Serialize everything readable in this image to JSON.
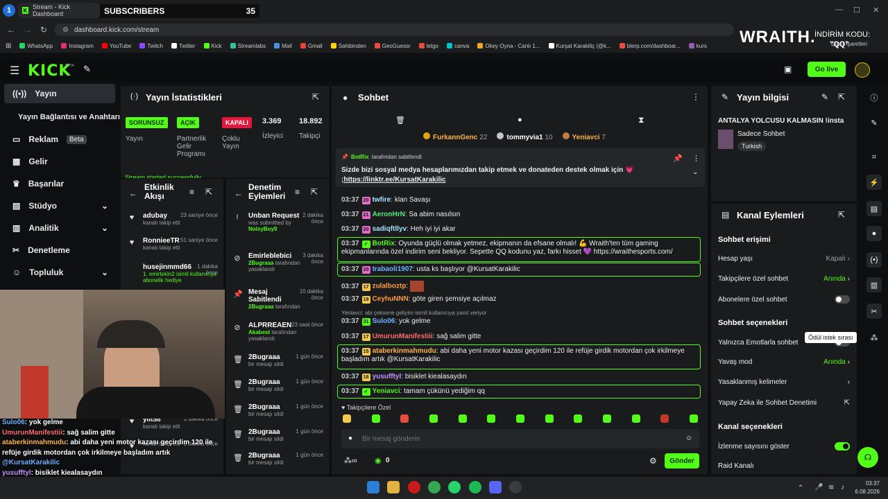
{
  "browser": {
    "tab_number": "1",
    "tab_title": "Stream - Kick Dashboard",
    "subs_label": "SUBSCRIBERS",
    "subs_count": "35",
    "url": "dashboard.kick.com/stream",
    "bookmarks": [
      "WhatsApp",
      "Instagram",
      "YouTube",
      "Twitch",
      "Twitter",
      "Kick",
      "Streamlabs",
      "Mail",
      "Gmail",
      "Sahibinden",
      "GeoGuessr",
      "letgo",
      "canva",
      "Okey Oyna - Canlı 1...",
      "Kurşat Karakiliç (@k...",
      "blerp.com/dashboar...",
      "kurs"
    ],
    "other_bookmarks": "Diğer İşaretleri"
  },
  "ad": {
    "brand": "WRAITH.",
    "code_label": "İNDİRİM KODU:",
    "code": "\"QQ\""
  },
  "header": {
    "logo": "KICK",
    "beta": "BETA",
    "go_live": "Go live"
  },
  "sidebar": {
    "items": [
      {
        "label": "Yayın",
        "icon": "broadcast-icon"
      },
      {
        "label": "Yayın Bağlantısı ve Anahtarı",
        "icon": ""
      },
      {
        "label": "Reklam",
        "icon": "monitor-icon",
        "badge": "Beta"
      },
      {
        "label": "Gelir",
        "icon": "chart-icon"
      },
      {
        "label": "Başarılar",
        "icon": "trophy-icon"
      },
      {
        "label": "Stüdyo",
        "icon": "film-icon"
      },
      {
        "label": "Analitik",
        "icon": "bar-icon"
      },
      {
        "label": "Denetleme",
        "icon": "wrench-icon"
      },
      {
        "label": "Topluluk",
        "icon": "people-icon"
      }
    ]
  },
  "stats": {
    "title": "Yayın İstatistikleri",
    "sorunsuz": "SORUNSUZ",
    "yayin": "Yayın",
    "acik": "AÇIK",
    "partner": "Partnerlik Gelir Programı",
    "kapali": "KAPALI",
    "coklu": "Çoklu Yayın",
    "viewers": "3.369",
    "viewers_label": "İzleyici",
    "followers": "18.892",
    "followers_label": "Takipçi",
    "started": "Stream started successfully"
  },
  "activity": {
    "title": "Etkinlik Akışı",
    "items": [
      {
        "name": "adubay",
        "sub": "kanalı takip etti",
        "time": "23 saniye önce"
      },
      {
        "name": "RonnieeTR",
        "sub": "kanalı takip etti",
        "time": "51 saniye önce"
      },
      {
        "name": "husejinmmd66",
        "sub": "1. emirtekin2 isimli kullanıcıya abonelik hediye",
        "time": "1 dakika önce"
      },
      {
        "name": "yiit58",
        "sub": "kanalı takip etti",
        "time": "1 dakika önce"
      },
      {
        "name": "",
        "sub": "kanalı takip etti",
        "time": "1 dakika önce"
      }
    ]
  },
  "moderation": {
    "title": "Denetim Eylemleri",
    "items": [
      {
        "name": "Unban Request",
        "sub": "was submitted by",
        "user": "NolsyBoy9",
        "time": "2 dakika önce"
      },
      {
        "name": "Emirleblebici",
        "user": "2Bugraaa",
        "sub": "tarafından yasaklandı",
        "time": "3 dakika önce"
      },
      {
        "name": "Mesaj Sabitlendi",
        "user": "2Bugraaa",
        "sub": "tarafından",
        "time": "10 dakika önce"
      },
      {
        "name": "ALPRREAEN",
        "user": "Akabest",
        "sub": "tarafından yasaklandı",
        "time": "23 saat önce"
      },
      {
        "name": "2Bugraaa",
        "sub": "bir mesajı sildi",
        "time": "1 gün önce"
      },
      {
        "name": "2Bugraaa",
        "sub": "bir mesajı sildi",
        "time": "1 gün önce"
      },
      {
        "name": "2Bugraaa",
        "sub": "bir mesajı sildi",
        "time": "1 gün önce"
      },
      {
        "name": "2Bugraaa",
        "sub": "bir mesajı sildi",
        "time": "1 gün önce"
      },
      {
        "name": "2Bugraaa",
        "sub": "bir mesajı sildi",
        "time": "1 gün önce"
      }
    ]
  },
  "chat": {
    "title": "Sohbet",
    "top": [
      {
        "name": "FurkannGenc",
        "count": "22"
      },
      {
        "name": "tommyvia1",
        "count": "10"
      },
      {
        "name": "Yeniavci",
        "count": "7"
      }
    ],
    "pinned_by": "BotRix",
    "pinned_suffix": "tarafından sabitlendi",
    "pinned_text": "Sizde bizi sosyal medya hesaplarımızdan takip etmek ve donateden destek olmak için 💗",
    "pinned_link": ";https://linktr.ee/KursatKarakilic",
    "messages": [
      {
        "time": "03:37",
        "lvl": "20",
        "user": "twfire",
        "text": "klan Savaşı",
        "color": "#a9e2ff"
      },
      {
        "time": "03:37",
        "lvl": "21",
        "user": "AeronHrN",
        "text": "Sa abim nasılsın",
        "color": "#57ec7d"
      },
      {
        "time": "03:37",
        "lvl": "20",
        "user": "sadiqftllyv",
        "text": "Heh iyi iyi akar",
        "color": "#a9e2ff"
      },
      {
        "time": "03:37",
        "lvl": "",
        "user": "BotRix",
        "text": "Oyunda güçlü olmak yetmez, ekipmanın da efsane olmalı! 💪 Wraith'ten tüm gaming",
        "text2": "ekipmanlarında özel indirim seni bekliyor. Sepette QQ kodunu yaz, farkı hisset 💜 https://wraithesports.com/",
        "color": "#53fc18"
      },
      {
        "time": "03:37",
        "lvl": "20",
        "user": "trabaoli1907",
        "text": "usta ks başlıyor @KursatKarakilic",
        "color": "#6fb2ff"
      },
      {
        "time": "03:37",
        "lvl": "17",
        "user": "zulalboztp",
        "text": "",
        "color": "#ff9b3d"
      },
      {
        "time": "03:37",
        "lvl": "19",
        "user": "CeyhuNNN",
        "text": "göte giren şemsiye açılmaz",
        "color": "#ff9b3d"
      },
      {
        "time": "",
        "lvl": "",
        "user": "",
        "text": "Yeniavci: abi çeksene geliyim isimli kullanıcıya yanıt veriyor",
        "color": "#9aa0a3"
      },
      {
        "time": "03:37",
        "lvl": "31",
        "user": "Sulo06",
        "text": "yok gelme",
        "color": "#6fb2ff"
      },
      {
        "time": "03:37",
        "lvl": "17",
        "user": "UmurunManifestiii",
        "text": "sağ salim gitte",
        "color": "#ff6b6b"
      },
      {
        "time": "03:37",
        "lvl": "15",
        "user": "ataberkinmahmudu",
        "text": "abi daha yeni motor kazası geçirdim 120 ile refüje girdik motordan çok irkilmeye",
        "text2": "başladım artık @KursatKarakilic",
        "color": "#ffb44a"
      },
      {
        "time": "03:37",
        "lvl": "18",
        "user": "yusufftyl",
        "text": "bisiklet kiealasaydın",
        "color": "#c792ff"
      },
      {
        "time": "03:37",
        "lvl": "",
        "user": "Yeniavci",
        "text": "tamam çükünü yediğim qq",
        "color": "#53fc18"
      }
    ],
    "followers_only": "Takipçilere Özel",
    "placeholder": "Bir mesaj gönderin",
    "points": "0",
    "send": "Gönder"
  },
  "info": {
    "title": "Yayın bilgisi",
    "stream_title": "ANTALYA YOLCUSU KALMASIN !insta",
    "category": "Sadece Sohbet",
    "language": "Turkish"
  },
  "channel": {
    "title": "Kanal Eylemleri",
    "chat_access": "Sohbet erişimi",
    "rows": [
      {
        "label": "Hesap yaşı",
        "value": "Kapalı"
      },
      {
        "label": "Takipçilere özel sohbet",
        "value": "Anında"
      },
      {
        "label": "Abonelere özel sohbet",
        "value": ""
      }
    ],
    "chat_options": "Sohbet seçenekleri",
    "rows2": [
      {
        "label": "Yalnızca Emotlarla sohbet",
        "value": ""
      },
      {
        "label": "Yavaş mod",
        "value": "Anında"
      },
      {
        "label": "Yasaklanmış kelimeler",
        "value": ""
      },
      {
        "label": "Yapay Zeka ile Sohbet Denetimi",
        "value": ""
      }
    ],
    "channel_options": "Kanal seçenekleri",
    "rows3": [
      {
        "label": "İzlenme sayısını göster",
        "value": ""
      },
      {
        "label": "Raid Kanalı",
        "value": ""
      }
    ],
    "tooltip": "Ödül istek sırası"
  },
  "overlay": {
    "lines": [
      {
        "user": "Sulo06",
        "text": ": yok gelme",
        "color": "#6fb2ff"
      },
      {
        "user": "UmurunManifestiii",
        "text": ": sağ salim gitte",
        "color": "#ff6b6b"
      },
      {
        "user": "ataberkinmahmudu",
        "text": ": abi daha yeni motor kazası geçirdim 120 ile",
        "color": "#ffb44a"
      },
      {
        "user": "",
        "text": "refüje girdik motordan çok irkilmeye başladım artık",
        "color": "#fff"
      },
      {
        "user": "@KursatKarakilic",
        "text": "",
        "color": "#6fb2ff"
      },
      {
        "user": "yusufftyl",
        "text": ": bisiklet kiealasaydın",
        "color": "#c792ff"
      },
      {
        "user": "Yeniavci",
        "text": ": tamam çükünü yediğim qq",
        "color": "#53fc18"
      }
    ]
  },
  "taskbar": {
    "time": "03:37",
    "date": "6.08.2026"
  }
}
